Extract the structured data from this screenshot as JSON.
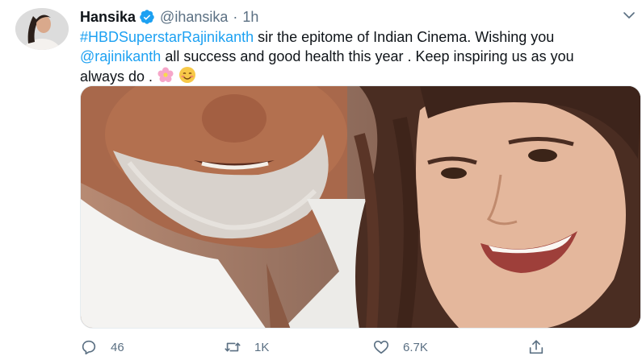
{
  "tweet": {
    "author_name": "Hansika",
    "handle": "@ihansika",
    "separator": "·",
    "time": "1h",
    "text_parts": {
      "hashtag": "#HBDSuperstarRajinikanth",
      "line1_rest": " sir  the epitome of Indian Cinema. Wishing you",
      "mention": "@rajinikanth",
      "line2_rest": " all success and good health this year . Keep inspiring us as you",
      "line3": "always do . "
    },
    "actions": {
      "replies": "46",
      "retweets": "1K",
      "likes": "6.7K"
    }
  },
  "icons": [
    "avatar",
    "verified-badge-icon",
    "chevron-down-icon",
    "blossom-emoji",
    "smiling-face-emoji",
    "reply-icon",
    "retweet-icon",
    "like-icon",
    "share-icon"
  ],
  "colors": {
    "accent": "#1da1f2",
    "text_primary": "#0f1419",
    "text_secondary": "#5b7083"
  }
}
